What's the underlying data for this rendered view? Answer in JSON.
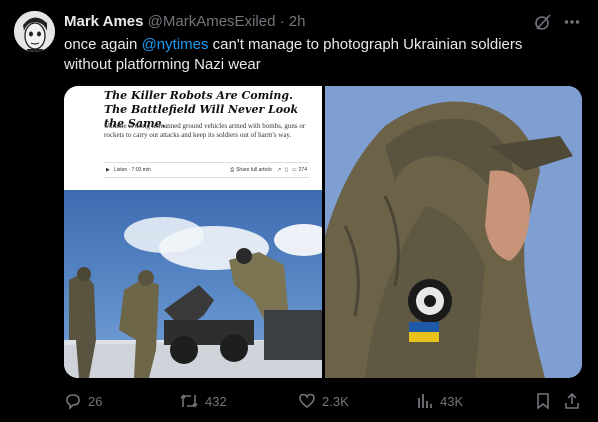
{
  "author": {
    "name": "Mark Ames",
    "handle": "@MarkAmesExiled",
    "separator": "·",
    "time": "2h"
  },
  "tweet": {
    "text_before": "once again ",
    "mention": "@nytimes",
    "text_after": " can't manage to photograph Ukrainian soldiers without platforming Nazi wear"
  },
  "article": {
    "title": "The Killer Robots Are Coming. The Battlefield Will Never Look the Same.",
    "subtitle": "Ukraine is using unmanned ground vehicles armed with bombs, guns or rockets to carry out attacks and keep its soldiers out of harm's way.",
    "listen": "Listen · 7:03 min",
    "share": "Share full article",
    "comments": "274"
  },
  "stats": {
    "replies": "26",
    "reposts": "432",
    "likes": "2.3K",
    "views": "43K"
  },
  "colors": {
    "accent": "#1d9bf0",
    "muted": "#71767b",
    "text": "#e7e9ea",
    "bg": "#000000"
  }
}
